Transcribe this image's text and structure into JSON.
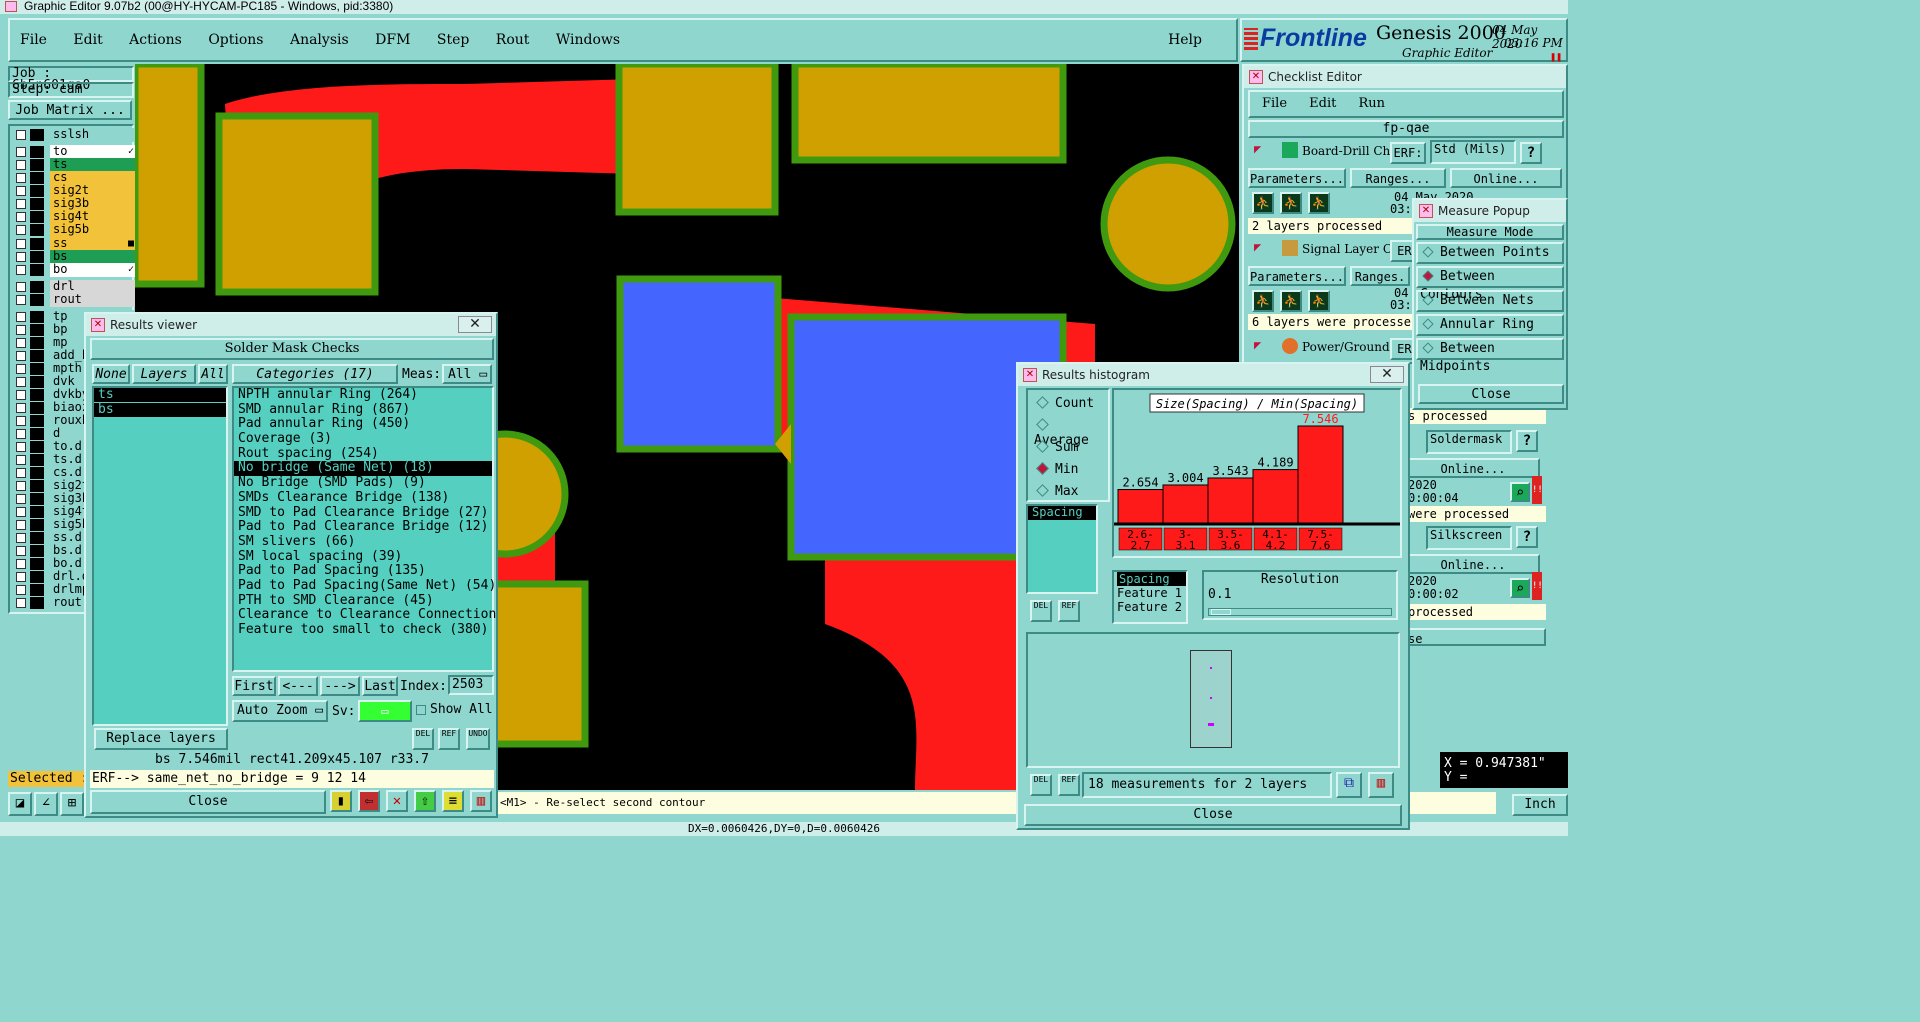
{
  "window": {
    "title": "Graphic Editor 9.07b2 (00@HY-HYCAM-PC185 - Windows, pid:3380)"
  },
  "menu": {
    "items": [
      "File",
      "Edit",
      "Actions",
      "Options",
      "Analysis",
      "DFM",
      "Step",
      "Rout",
      "Windows"
    ],
    "help": "Help"
  },
  "brand": {
    "logo": "Frontline",
    "product": "Genesis 2000",
    "subtitle": "Graphic Editor",
    "date": "04 May 2020",
    "time": "03:16 PM"
  },
  "job": {
    "job": "Job : 6b5n601qa0",
    "step": "Step: cam",
    "matrix_button": "Job Matrix ..."
  },
  "layers": [
    {
      "name": "sslsh",
      "color": "#8fd6cf"
    },
    {
      "name": "to",
      "color": "#ffffff",
      "mark": "✓"
    },
    {
      "name": "ts",
      "color": "#1e9e55"
    },
    {
      "name": "cs",
      "color": "#f2c23a"
    },
    {
      "name": "sig2t",
      "color": "#f2c23a"
    },
    {
      "name": "sig3b",
      "color": "#f2c23a"
    },
    {
      "name": "sig4t",
      "color": "#f2c23a"
    },
    {
      "name": "sig5b",
      "color": "#f2c23a"
    },
    {
      "name": "ss",
      "color": "#f2c23a",
      "mark": "■"
    },
    {
      "name": "bs",
      "color": "#1e9e55"
    },
    {
      "name": "bo",
      "color": "#ffffff",
      "mark": "✓"
    },
    {
      "name": "drl",
      "color": "#d7d7d7"
    },
    {
      "name": "rout",
      "color": "#d7d7d7"
    },
    {
      "name": "tp",
      "color": "#8fd6cf"
    },
    {
      "name": "bp",
      "color": "#8fd6cf"
    },
    {
      "name": "mp",
      "color": "#8fd6cf"
    },
    {
      "name": "add_hole",
      "color": "#8fd6cf"
    },
    {
      "name": "mpth",
      "color": "#8fd6cf"
    },
    {
      "name": "dvk",
      "color": "#8fd6cf"
    },
    {
      "name": "dvkby",
      "color": "#8fd6cf"
    },
    {
      "name": "biaozhu",
      "color": "#8fd6cf"
    },
    {
      "name": "rouxb",
      "color": "#8fd6cf"
    },
    {
      "name": "d",
      "color": "#8fd6cf"
    },
    {
      "name": "to.d",
      "color": "#8fd6cf"
    },
    {
      "name": "ts.d",
      "color": "#8fd6cf"
    },
    {
      "name": "cs.d",
      "color": "#8fd6cf"
    },
    {
      "name": "sig2t.d",
      "color": "#8fd6cf"
    },
    {
      "name": "sig3b.d",
      "color": "#8fd6cf"
    },
    {
      "name": "sig4t.d",
      "color": "#8fd6cf"
    },
    {
      "name": "sig5b.d",
      "color": "#8fd6cf"
    },
    {
      "name": "ss.d",
      "color": "#8fd6cf"
    },
    {
      "name": "bs.d",
      "color": "#8fd6cf"
    },
    {
      "name": "bo.d",
      "color": "#8fd6cf"
    },
    {
      "name": "drl.d",
      "color": "#8fd6cf"
    },
    {
      "name": "drlmpth",
      "color": "#8fd6cf"
    },
    {
      "name": "rout.d",
      "color": "#8fd6cf"
    }
  ],
  "selected": "Selected : 0",
  "status": {
    "prompt": "<M1> - Re-select second contour",
    "coords": "DX=0.0060426,DY=0,D=0.0060426",
    "unit": "Inch",
    "xy_x": "X = 0.947381\"",
    "xy_y": "Y = "
  },
  "results_viewer": {
    "title": "Results viewer",
    "section": "Solder Mask Checks",
    "none": "None",
    "layers_label": "Layers",
    "all": "All",
    "layers": [
      "ts",
      "bs"
    ],
    "categories_label": "Categories (17)",
    "meas_label": "Meas:",
    "meas_value": "All",
    "categories": [
      "NPTH annular Ring (264)",
      "SMD annular Ring (867)",
      "Pad annular Ring (450)",
      "Coverage (3)",
      "Rout spacing (254)",
      "No bridge (Same Net) (18)",
      "No Bridge (SMD Pads) (9)",
      "SMDs Clearance Bridge (138)",
      "SMD to Pad Clearance Bridge (27)",
      "Pad to Pad Clearance Bridge (12)",
      "SM slivers (66)",
      "SM local spacing (39)",
      "Pad to Pad Spacing (135)",
      "Pad to Pad Spacing(Same Net) (54)",
      "PTH to SMD Clearance (45)",
      "Clearance to Clearance Connection",
      "Feature too small to check (380)"
    ],
    "selected_index": 5,
    "first": "First",
    "prev": "<---",
    "next": "--->",
    "last": "Last",
    "index_label": "Index:",
    "index_value": "2503",
    "auto_zoom": "Auto Zoom",
    "sv": "Sv:",
    "show_all": "Show All",
    "replace_layers": "Replace layers",
    "del": "DEL",
    "ref": "REF",
    "undo": "UNDO",
    "info": "bs 7.546mil  rect41.209x45.107 r33.7",
    "erf": "ERF--> same_net_no_bridge = 9 12 14",
    "close": "Close"
  },
  "checklist": {
    "title": "Checklist Editor",
    "menu": [
      "File",
      "Edit",
      "Run"
    ],
    "name": "fp-qae",
    "rows": [
      {
        "label": "Board-Drill Che",
        "erf": "ERF:",
        "erf_value": "Std (Mils)",
        "params": "Parameters...",
        "ranges": "Ranges...",
        "online": "Online...",
        "date": "04 May 2020",
        "time": "03:26 PM -",
        "msg": "2 layers processed"
      },
      {
        "label": "Signal Layer Ch",
        "erf": "ERF",
        "params": "Parameters...",
        "ranges": "Ranges.",
        "date": "04 May",
        "time": "03:26 PM -",
        "msg": "6 layers were processe"
      },
      {
        "label": "Power/Ground C",
        "erf": "ERF",
        "params": "Parameters..."
      }
    ],
    "partial": [
      {
        "msg": "s processed",
        "erf_value": "Soldermask",
        "online": "Online...",
        "date": "2020",
        "time": "0:00:04",
        "msg2": "were processed"
      },
      {
        "erf_value": "Silkscreen",
        "online": "Online...",
        "date": "2020",
        "time": "0:00:02",
        "msg2": "processed"
      }
    ],
    "close_partial": "se"
  },
  "measure": {
    "title": "Measure Popup",
    "header": "Measure Mode",
    "modes": [
      "Between Points",
      "Between Contours",
      "Between Nets",
      "Annular Ring",
      "Between Midpoints"
    ],
    "selected": 1,
    "close": "Close"
  },
  "histogram": {
    "title": "Results histogram",
    "options": [
      "Count",
      "Average",
      "Sum",
      "Min",
      "Max"
    ],
    "selected_option": 3,
    "list": [
      "Spacing"
    ],
    "chart_title": "Size(Spacing) / Min(Spacing)",
    "bins": [
      {
        "label": "2.6-2.7",
        "value": 2.654
      },
      {
        "label": "3-3.1",
        "value": 3.004
      },
      {
        "label": "3.5-3.6",
        "value": 3.543
      },
      {
        "label": "4.1-4.2",
        "value": 4.189
      },
      {
        "label": "7.5-7.6",
        "value": 7.546
      }
    ],
    "fields": [
      "Spacing",
      "Feature 1",
      "Feature 2"
    ],
    "resolution_label": "Resolution",
    "resolution_value": "0.1",
    "del": "DEL",
    "ref": "REF",
    "summary": "18 measurements for 2 layers",
    "close": "Close"
  },
  "chart_data": {
    "type": "bar",
    "title": "Size(Spacing) / Min(Spacing)",
    "categories": [
      "2.6-2.7",
      "3-3.1",
      "3.5-3.6",
      "4.1-4.2",
      "7.5-7.6"
    ],
    "values": [
      2.654,
      3.004,
      3.543,
      4.189,
      7.546
    ]
  }
}
